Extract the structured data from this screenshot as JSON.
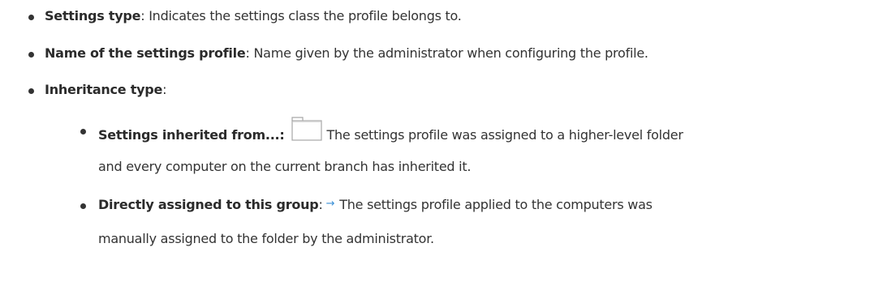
{
  "items": [
    {
      "bold": "Settings type",
      "text": ": Indicates the settings class the profile belongs to."
    },
    {
      "bold": "Name of the settings profile",
      "text": ": Name given by the administrator when configuring the profile."
    },
    {
      "bold": "Inheritance type",
      "text": ":"
    }
  ],
  "subitems": [
    {
      "bold": "Settings inherited from...:",
      "icon": "folder-icon",
      "text": "The settings profile was assigned to a higher-level folder",
      "continuation": "and every computer on the current branch has inherited it."
    },
    {
      "bold": "Directly assigned to this group",
      "separator": ":",
      "icon": "arrow-right-icon",
      "arrow_glyph": "→",
      "text": "The settings profile applied to the computers was",
      "continuation": "manually assigned to the folder by the administrator."
    }
  ],
  "colors": {
    "text": "#333333",
    "arrow": "#3a8fd6",
    "folder_border": "#a6a6a6"
  }
}
